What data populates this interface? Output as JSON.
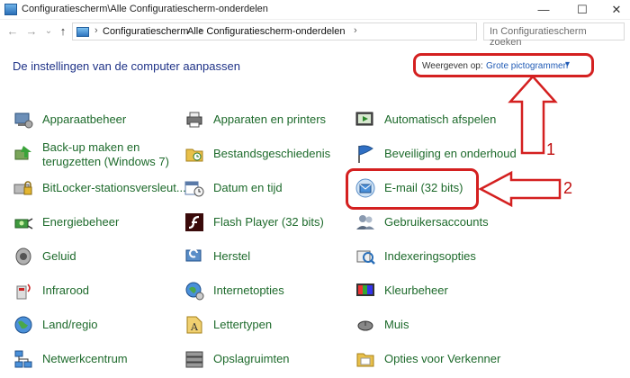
{
  "window": {
    "title": "Configuratiescherm\\Alle Configuratiescherm-onderdelen",
    "minimize": "—",
    "maximize": "☐",
    "close": "✕"
  },
  "nav": {
    "back": "←",
    "forward": "→",
    "recent": "⌄",
    "up": "↑"
  },
  "address": {
    "crumbs": [
      "Configuratiescherm",
      "Alle Configuratiescherm-onderdelen"
    ],
    "separator": "›",
    "search_placeholder": "In Configuratiescherm zoeken"
  },
  "main": {
    "heading": "De instellingen van de computer aanpassen",
    "view_by_label": "Weergeven op:",
    "view_by_value": "Grote pictogrammen",
    "view_by_arrow": "▾"
  },
  "annotations": {
    "number_1": "1",
    "number_2": "2",
    "color": "#d42020"
  },
  "items": [
    {
      "label": "Apparaatbeheer",
      "icon": "device-manager-icon"
    },
    {
      "label": "Apparaten en printers",
      "icon": "printer-icon"
    },
    {
      "label": "Automatisch afspelen",
      "icon": "autoplay-icon"
    },
    {
      "label_line1": "Back-up maken en",
      "label_line2": "terugzetten (Windows 7)",
      "icon": "backup-icon"
    },
    {
      "label": "Bestandsgeschiedenis",
      "icon": "file-history-icon"
    },
    {
      "label": "Beveiliging en onderhoud",
      "icon": "security-flag-icon"
    },
    {
      "label": "BitLocker-stationsversleut...",
      "icon": "bitlocker-icon"
    },
    {
      "label": "Datum en tijd",
      "icon": "calendar-clock-icon"
    },
    {
      "label": "E-mail (32 bits)",
      "icon": "mail-icon"
    },
    {
      "label": "Energiebeheer",
      "icon": "power-icon"
    },
    {
      "label": "Flash Player (32 bits)",
      "icon": "flash-icon"
    },
    {
      "label": "Gebruikersaccounts",
      "icon": "users-icon"
    },
    {
      "label": "Geluid",
      "icon": "speaker-icon"
    },
    {
      "label": "Herstel",
      "icon": "recovery-icon"
    },
    {
      "label": "Indexeringsopties",
      "icon": "indexing-icon"
    },
    {
      "label": "Infrarood",
      "icon": "infrared-icon"
    },
    {
      "label": "Internetopties",
      "icon": "internet-options-icon"
    },
    {
      "label": "Kleurbeheer",
      "icon": "color-management-icon"
    },
    {
      "label": "Land/regio",
      "icon": "globe-icon"
    },
    {
      "label": "Lettertypen",
      "icon": "fonts-icon"
    },
    {
      "label": "Muis",
      "icon": "mouse-icon"
    },
    {
      "label": "Netwerkcentrum",
      "icon": "network-icon"
    },
    {
      "label": "Opslagruimten",
      "icon": "storage-icon"
    },
    {
      "label": "Opties voor Verkenner",
      "icon": "folder-options-icon"
    }
  ]
}
